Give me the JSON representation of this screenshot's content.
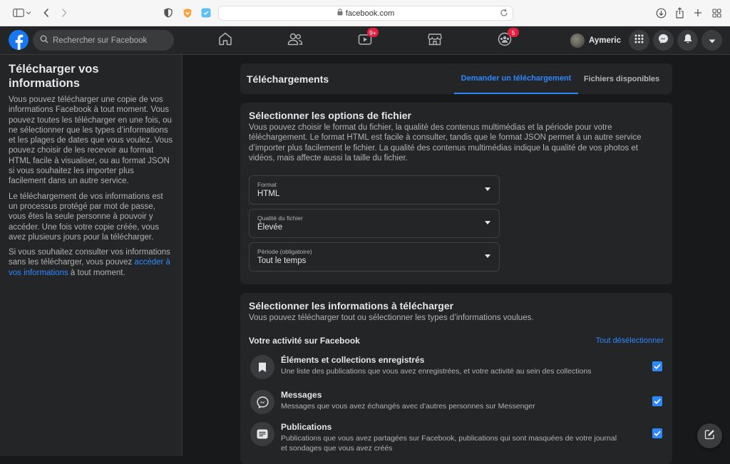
{
  "browser": {
    "url": "facebook.com"
  },
  "nav": {
    "search_placeholder": "Rechercher sur Facebook",
    "watch_badge": "9+",
    "groups_badge": "5",
    "user_name": "Aymeric"
  },
  "sidebar": {
    "title": "Télécharger vos informations",
    "paragraph1": "Vous pouvez télécharger une copie de vos informations Facebook à tout moment. Vous pouvez toutes les télécharger en une fois, ou ne sélectionner que les types d’informations et les plages de dates que vous voulez. Vous pouvez choisir de les recevoir au format HTML facile à visualiser, ou au format JSON si vous souhaitez les importer plus facilement dans un autre service.",
    "paragraph2": "Le téléchargement de vos informations est un processus protégé par mot de passe, vous êtes la seule personne à pouvoir y accéder. Une fois votre copie créée, vous avez plusieurs jours pour la télécharger.",
    "paragraph3_before": "Si vous souhaitez consulter vos informations sans les télécharger, vous pouvez ",
    "paragraph3_link": "accéder à vos informations",
    "paragraph3_after": " à tout moment."
  },
  "downloads": {
    "title": "Téléchargements",
    "tab_request": "Demander un téléchargement",
    "tab_files": "Fichiers disponibles"
  },
  "options": {
    "title": "Sélectionner les options de fichier",
    "description": "Vous pouvez choisir le format du fichier, la qualité des contenus multimédias et la période pour votre téléchargement. Le format HTML est facile à consulter, tandis que le format JSON permet à un autre service d’importer plus facilement le fichier. La qualité des contenus multimédias indique la qualité de vos photos et vidéos, mais affecte aussi la taille du fichier.",
    "format_label": "Format",
    "format_value": "HTML",
    "quality_label": "Qualité du fichier",
    "quality_value": "Élevée",
    "period_label": "Période (obligatoire)",
    "period_value": "Tout le temps"
  },
  "info": {
    "title": "Sélectionner les informations à télécharger",
    "description": "Vous pouvez télécharger tout ou sélectionner les types d’informations voulues.",
    "section_title": "Votre activité sur Facebook",
    "deselect_all": "Tout désélectionner",
    "items": [
      {
        "title": "Éléments et collections enregistrés",
        "description": "Une liste des publications que vous avez enregistrées, et votre activité au sein des collections",
        "icon": "bookmark-icon",
        "checked": true
      },
      {
        "title": "Messages",
        "description": "Messages que vous avez échangés avec d’autres personnes sur Messenger",
        "icon": "messenger-icon",
        "checked": true
      },
      {
        "title": "Publications",
        "description": "Publications que vous avez partagées sur Facebook, publications qui sont masquées de votre journal et sondages que vous avez créés",
        "icon": "post-icon",
        "checked": true
      }
    ]
  },
  "colors": {
    "accent": "#2d88ff",
    "fb_blue": "#1877f2",
    "badge_red": "#e41e3f",
    "background": "#18191a",
    "card": "#242526"
  }
}
